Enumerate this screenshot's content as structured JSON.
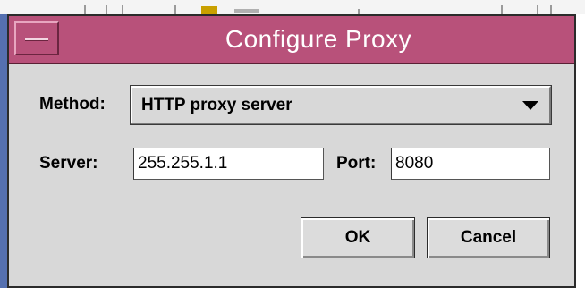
{
  "dialog": {
    "title": "Configure Proxy",
    "menu_icon": "window-menu-icon"
  },
  "form": {
    "method_label": "Method:",
    "method_value": "HTTP proxy server",
    "server_label": "Server:",
    "server_value": "255.255.1.1",
    "port_label": "Port:",
    "port_value": "8080"
  },
  "buttons": {
    "ok_label": "OK",
    "cancel_label": "Cancel"
  },
  "colors": {
    "titlebar": "#b8517a",
    "dialog_bg": "#d8d8d8"
  }
}
